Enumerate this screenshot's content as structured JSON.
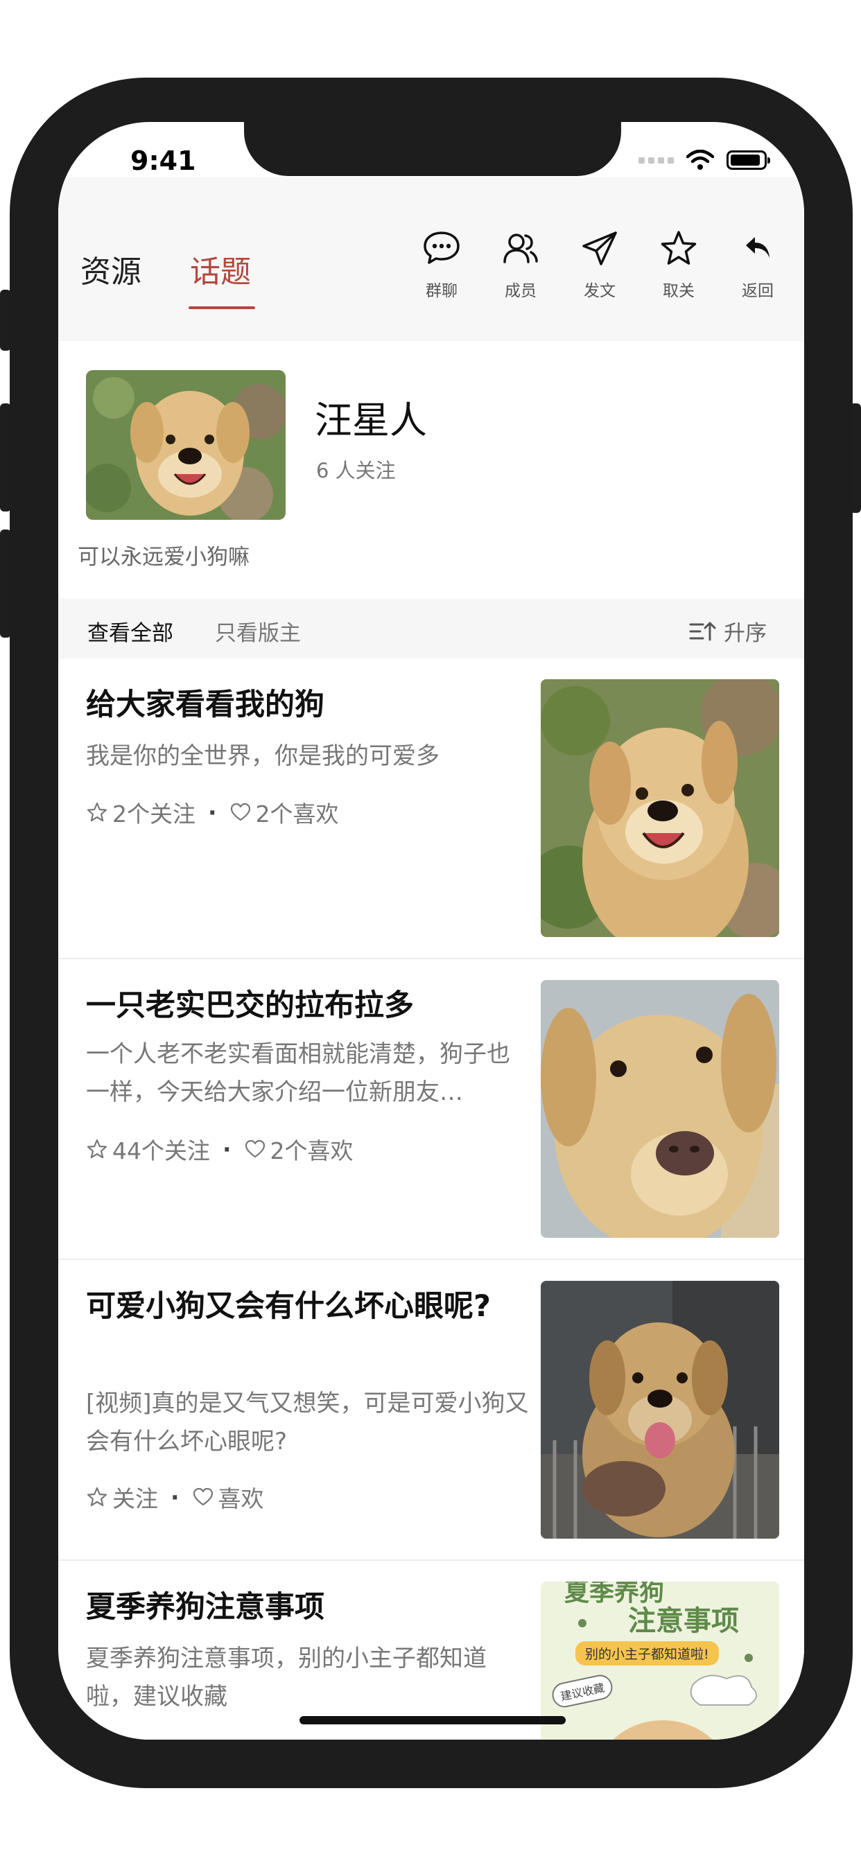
{
  "status": {
    "time": "9:41"
  },
  "header": {
    "tabs": [
      {
        "label": "资源",
        "active": false
      },
      {
        "label": "话题",
        "active": true
      }
    ],
    "actions": [
      {
        "label": "群聊",
        "icon": "chat-icon"
      },
      {
        "label": "成员",
        "icon": "members-icon"
      },
      {
        "label": "发文",
        "icon": "send-icon"
      },
      {
        "label": "取关",
        "icon": "star-icon"
      },
      {
        "label": "返回",
        "icon": "back-icon"
      }
    ],
    "accent_color": "#b1493f"
  },
  "topic": {
    "name": "汪星人",
    "followers": "6 人关注",
    "description": "可以永远爱小狗嘛"
  },
  "filters": {
    "all": "查看全部",
    "owner_only": "只看版主",
    "sort": "升序"
  },
  "posts": [
    {
      "title": "给大家看看我的狗",
      "summary": "我是你的全世界，你是我的可爱多",
      "follows": "2个关注",
      "likes": "2个喜欢"
    },
    {
      "title": "一只老实巴交的拉布拉多",
      "summary": "一个人老不老实看面相就能清楚，狗子也一样，今天给大家介绍一位新朋友…",
      "follows": "44个关注",
      "likes": "2个喜欢"
    },
    {
      "title": "可爱小狗又会有什么坏心眼呢?",
      "summary": "[视频]真的是又气又想笑，可是可爱小狗又会有什么坏心眼呢?",
      "follows": "关注",
      "likes": "喜欢"
    },
    {
      "title": "夏季养狗注意事项",
      "summary": "夏季养狗注意事项，别的小主子都知道啦，建议收藏",
      "poster": {
        "line1": "夏季养狗",
        "line2": "注意事项",
        "banner": "别的小主子都知道啦!",
        "stamp": "建议收藏"
      }
    }
  ]
}
